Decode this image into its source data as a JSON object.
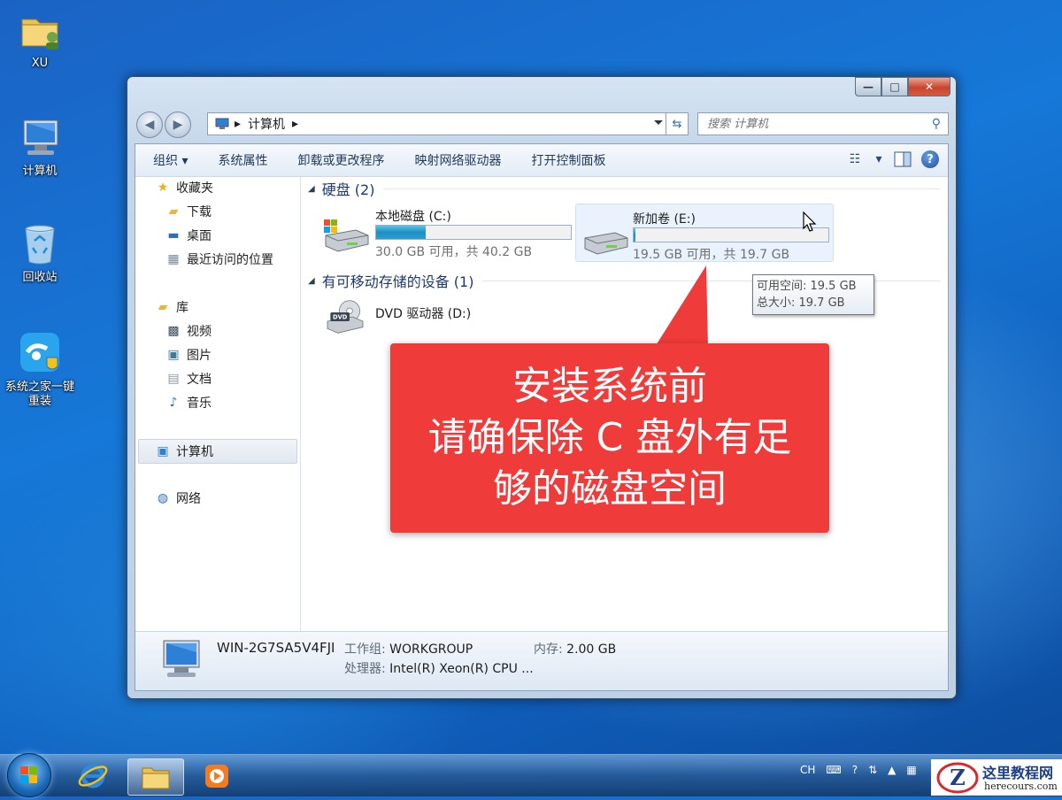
{
  "desktop": {
    "icons": [
      {
        "label": "XU",
        "icon": "user-folder-icon"
      },
      {
        "label": "计算机",
        "icon": "computer-icon"
      },
      {
        "label": "回收站",
        "icon": "recycle-bin-icon"
      },
      {
        "label": "系统之家一键重装",
        "icon": "reinstall-app-icon"
      }
    ]
  },
  "window": {
    "controls": {
      "minimize": "—",
      "maximize": "□",
      "close": "✕"
    },
    "nav": {
      "back": "◀",
      "forward": "▶"
    },
    "address": {
      "path_sep": "▸",
      "crumb": "计算机",
      "trail": "▸"
    },
    "search": {
      "placeholder": "搜索 计算机"
    },
    "toolbar": {
      "organize": "组织 ▾",
      "system_properties": "系统属性",
      "uninstall": "卸载或更改程序",
      "map_drive": "映射网络驱动器",
      "control_panel": "打开控制面板",
      "view_arrow": "▾",
      "help": "?"
    },
    "navpane": {
      "favorites": "收藏夹",
      "downloads": "下载",
      "desktop": "桌面",
      "recent": "最近访问的位置",
      "libraries": "库",
      "videos": "视频",
      "pictures": "图片",
      "documents": "文档",
      "music": "音乐",
      "computer": "计算机",
      "network": "网络"
    },
    "sections": {
      "hard_disks": "硬盘 (2)",
      "removable": "有可移动存储的设备 (1)"
    },
    "drives": [
      {
        "name": "本地磁盘 (C:)",
        "info": "30.0 GB 可用，共 40.2 GB",
        "used_fraction": 0.254
      },
      {
        "name": "新加卷 (E:)",
        "info": "19.5 GB 可用，共 19.7 GB",
        "used_fraction": 0.01
      },
      {
        "name": "DVD 驱动器 (D:)"
      }
    ],
    "details": {
      "computer_name": "WIN-2G7SA5V4FJI",
      "workgroup_label": "工作组:",
      "workgroup": "WORKGROUP",
      "memory_label": "内存:",
      "memory": "2.00 GB",
      "cpu_label": "处理器:",
      "cpu": "Intel(R) Xeon(R) CPU ..."
    }
  },
  "tooltip": {
    "free": "可用空间: 19.5 GB",
    "total": "总大小: 19.7 GB"
  },
  "callout": {
    "line1": "安装系统前",
    "line2": "请确保除 C 盘外有足",
    "line3": "够的磁盘空间"
  },
  "taskbar": {
    "tray_lang": "CH",
    "watermark_title": "这里教程网",
    "watermark_url": "herecours.com"
  },
  "colors": {
    "callout": "#ef3b3a",
    "drive_bar": "#1f8fc2",
    "desktop": "#1678d8"
  }
}
